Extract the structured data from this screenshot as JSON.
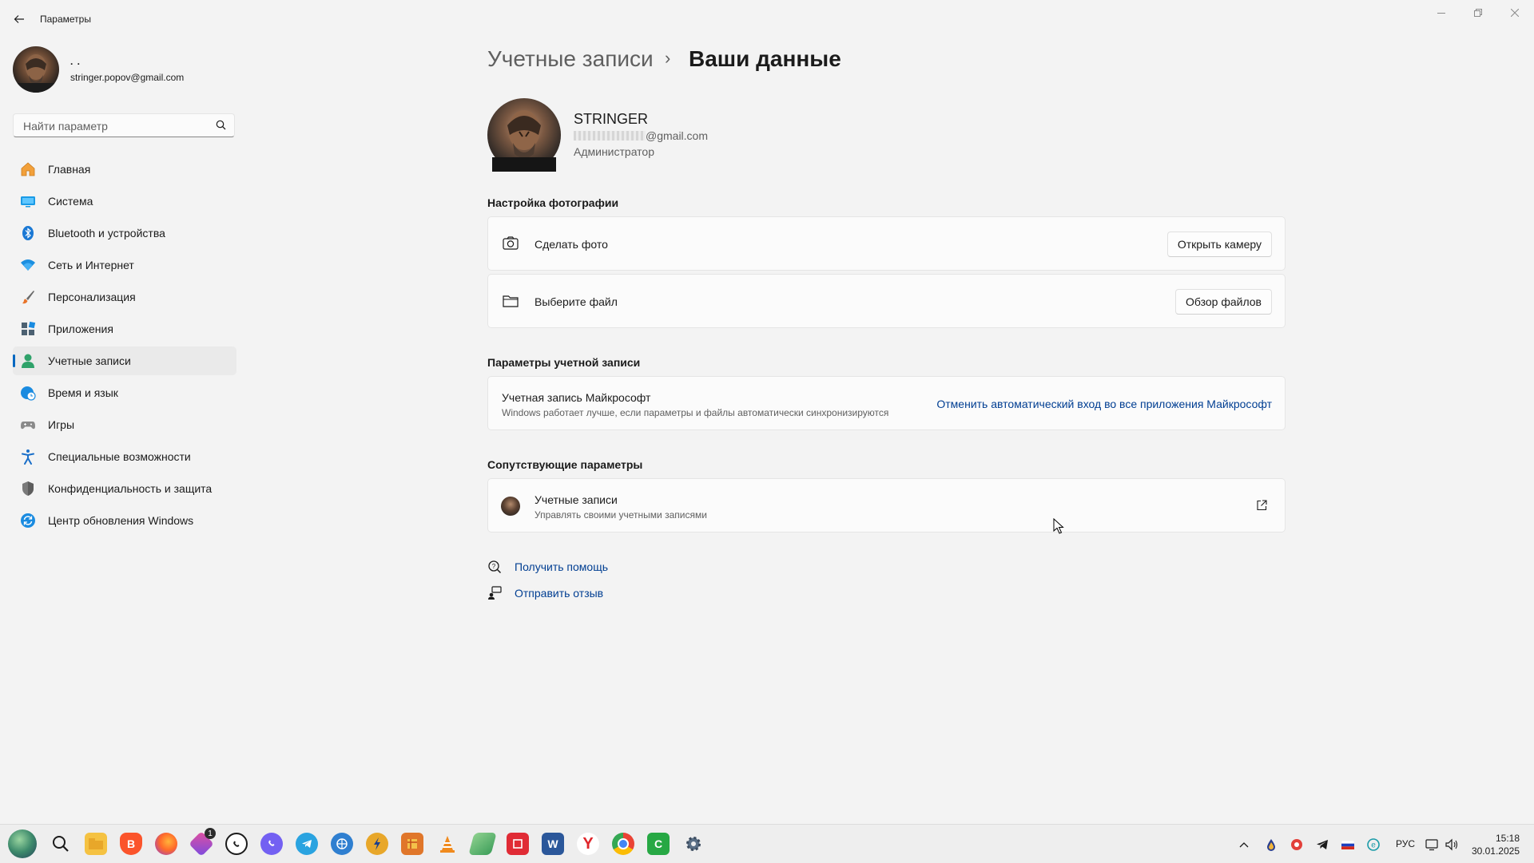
{
  "window": {
    "title": "Параметры"
  },
  "user": {
    "display_name": ". .",
    "email": "stringer.popov@gmail.com"
  },
  "search": {
    "placeholder": "Найти параметр"
  },
  "sidebar": {
    "items": [
      {
        "label": "Главная",
        "icon": "home-icon",
        "active": false
      },
      {
        "label": "Система",
        "icon": "system-icon",
        "active": false
      },
      {
        "label": "Bluetooth и устройства",
        "icon": "bluetooth-icon",
        "active": false
      },
      {
        "label": "Сеть и Интернет",
        "icon": "wifi-icon",
        "active": false
      },
      {
        "label": "Персонализация",
        "icon": "brush-icon",
        "active": false
      },
      {
        "label": "Приложения",
        "icon": "apps-icon",
        "active": false
      },
      {
        "label": "Учетные записи",
        "icon": "accounts-icon",
        "active": true
      },
      {
        "label": "Время и язык",
        "icon": "globe-clock-icon",
        "active": false
      },
      {
        "label": "Игры",
        "icon": "gamepad-icon",
        "active": false
      },
      {
        "label": "Специальные возможности",
        "icon": "accessibility-icon",
        "active": false
      },
      {
        "label": "Конфиденциальность и защита",
        "icon": "shield-icon",
        "active": false
      },
      {
        "label": "Центр обновления Windows",
        "icon": "update-icon",
        "active": false
      }
    ]
  },
  "breadcrumb": {
    "parent": "Учетные записи",
    "separator": "›",
    "current": "Ваши данные"
  },
  "profile": {
    "name": "STRINGER",
    "email_visible": "@gmail.com",
    "role": "Администратор"
  },
  "photo_section": {
    "title": "Настройка фотографии",
    "take_photo": {
      "label": "Сделать фото",
      "button": "Открыть камеру"
    },
    "choose_file": {
      "label": "Выберите файл",
      "button": "Обзор файлов"
    }
  },
  "account_section": {
    "title": "Параметры учетной записи",
    "ms_account": {
      "title": "Учетная запись Майкрософт",
      "subtitle": "Windows работает лучше, если параметры и файлы автоматически синхронизируются",
      "link": "Отменить автоматический вход во все приложения Майкрософт"
    }
  },
  "related_section": {
    "title": "Сопутствующие параметры",
    "accounts": {
      "title": "Учетные записи",
      "subtitle": "Управлять своими учетными записями"
    }
  },
  "help": {
    "get_help": "Получить помощь",
    "feedback": "Отправить отзыв"
  },
  "taskbar": {
    "badge_count": "1",
    "language": "РУС",
    "time": "15:18",
    "date": "30.01.2025"
  },
  "colors": {
    "accent": "#0067c0",
    "link": "#003e92",
    "background": "#f3f3f3",
    "card": "#fbfbfb"
  }
}
